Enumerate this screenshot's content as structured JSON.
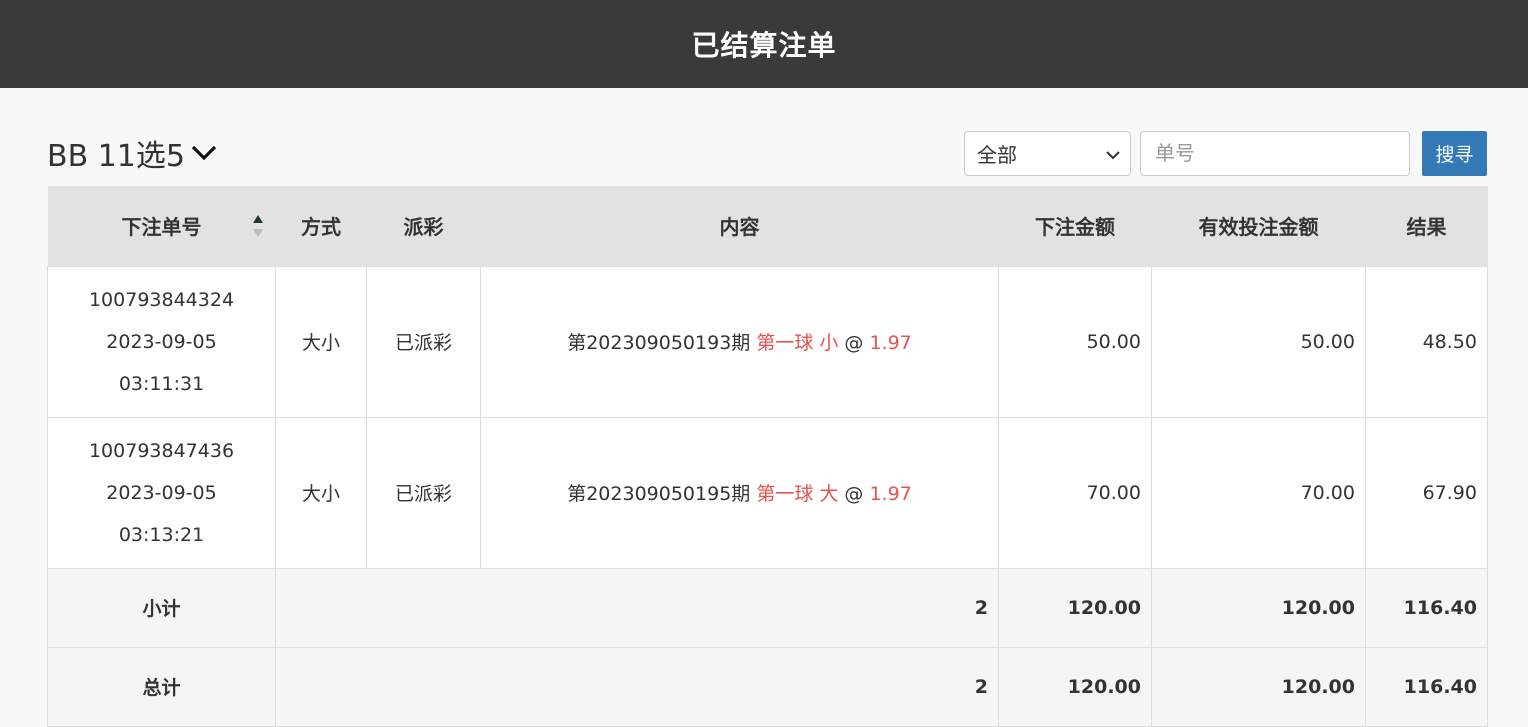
{
  "header": {
    "title": "已结算注单"
  },
  "toolbar": {
    "game_label": "BB 11选5",
    "filter_value": "全部",
    "search_placeholder": "单号",
    "search_button": "搜寻"
  },
  "table": {
    "columns": [
      "下注单号",
      "方式",
      "派彩",
      "内容",
      "下注金额",
      "有效投注金额",
      "结果"
    ],
    "rows": [
      {
        "order_id": "100793844324",
        "date": "2023-09-05",
        "time": "03:11:31",
        "method": "大小",
        "payout": "已派彩",
        "period": "第202309050193期",
        "pick": "第一球 小",
        "at": "@",
        "odds": "1.97",
        "bet_amount": "50.00",
        "valid_amount": "50.00",
        "result": "48.50"
      },
      {
        "order_id": "100793847436",
        "date": "2023-09-05",
        "time": "03:13:21",
        "method": "大小",
        "payout": "已派彩",
        "period": "第202309050195期",
        "pick": "第一球 大",
        "at": "@",
        "odds": "1.97",
        "bet_amount": "70.00",
        "valid_amount": "70.00",
        "result": "67.90"
      }
    ],
    "subtotal": {
      "label": "小计",
      "count": "2",
      "bet_amount": "120.00",
      "valid_amount": "120.00",
      "result": "116.40"
    },
    "total": {
      "label": "总计",
      "count": "2",
      "bet_amount": "120.00",
      "valid_amount": "120.00",
      "result": "116.40"
    }
  },
  "colors": {
    "header_bg": "#3a3a3a",
    "accent": "#337ab7",
    "highlight": "#e55353"
  }
}
